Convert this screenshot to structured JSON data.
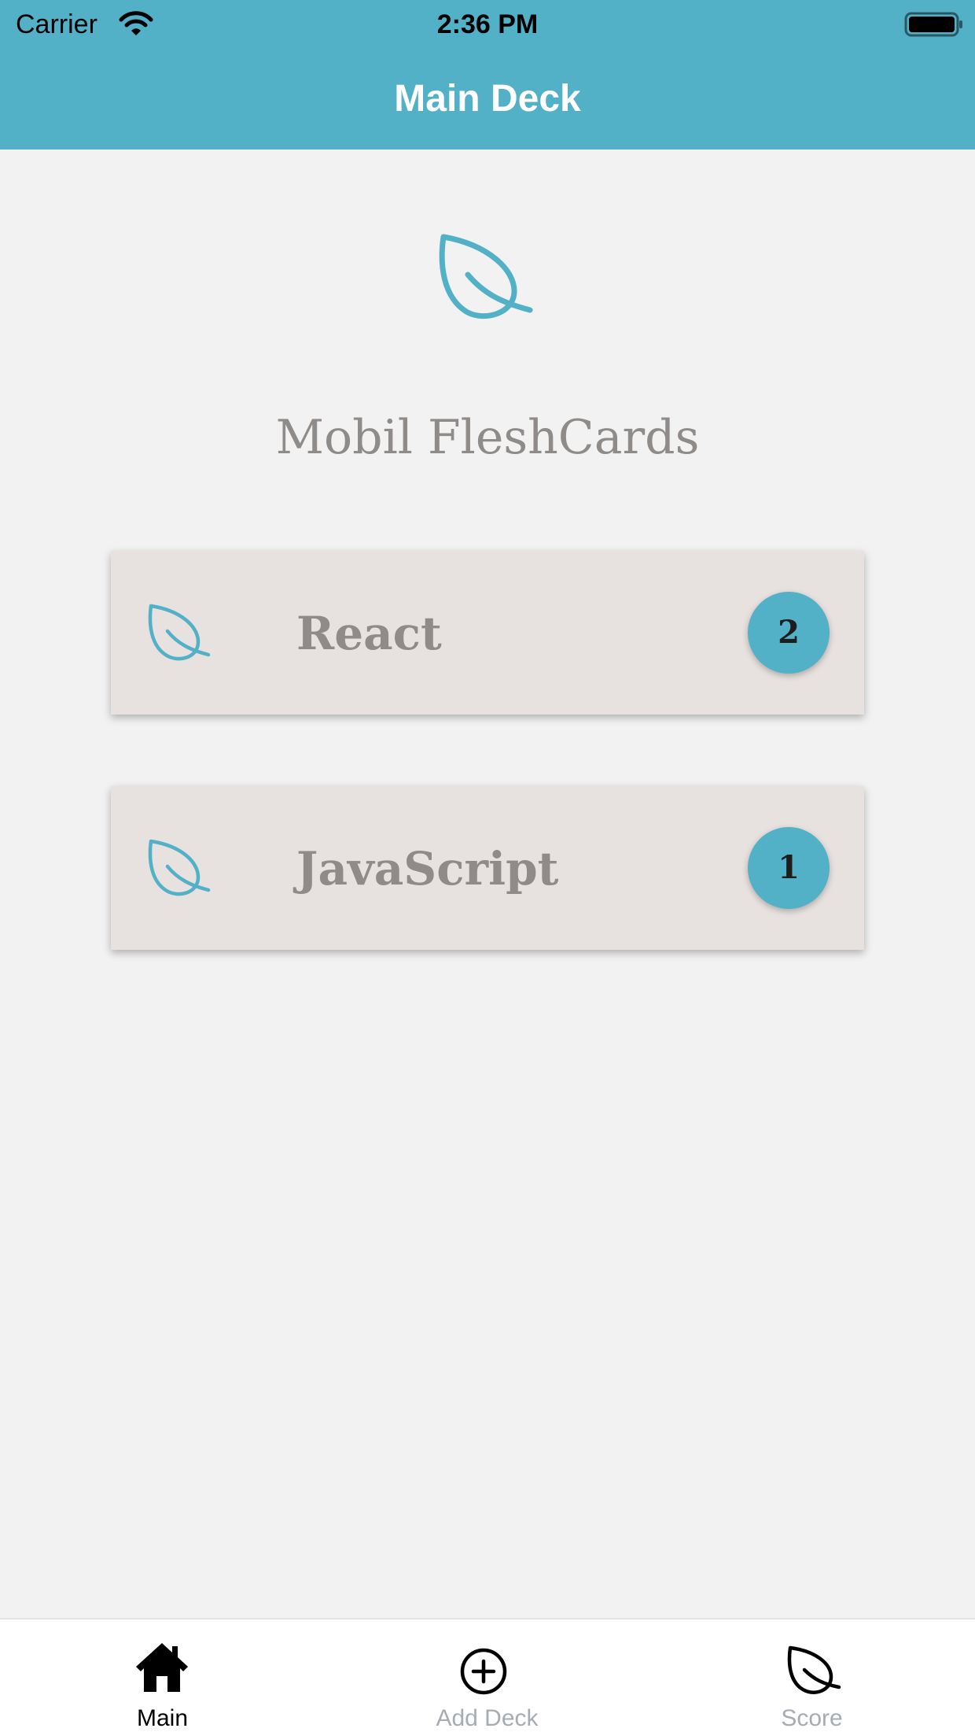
{
  "status_bar": {
    "carrier": "Carrier",
    "time": "2:36 PM"
  },
  "header": {
    "title": "Main Deck",
    "background": "#52b0c7"
  },
  "main": {
    "app_title": "Mobil FleshCards",
    "icon": "leaf-icon",
    "decks": [
      {
        "name": "React",
        "count": "2",
        "icon": "leaf-icon"
      },
      {
        "name": "JavaScript",
        "count": "1",
        "icon": "leaf-icon"
      }
    ]
  },
  "tab_bar": {
    "tabs": [
      {
        "label": "Main",
        "icon": "home-icon",
        "active": true
      },
      {
        "label": "Add Deck",
        "icon": "plus-circle-icon",
        "active": false
      },
      {
        "label": "Score",
        "icon": "leaf-icon",
        "active": false
      }
    ]
  },
  "colors": {
    "accent": "#52b0c7",
    "card": "#e7e1df",
    "muted_text": "#8f8b89",
    "background": "#f2f2f2"
  }
}
